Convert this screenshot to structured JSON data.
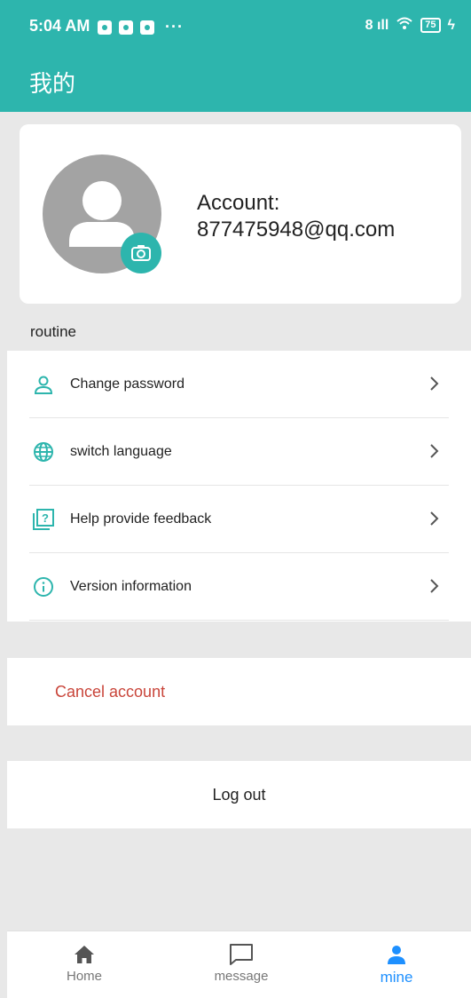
{
  "status_bar": {
    "time": "5:04 AM",
    "more": "···",
    "signal_text": "8 ıll",
    "battery": "75",
    "charge": "ϟ"
  },
  "app_bar": {
    "title": "我的"
  },
  "profile": {
    "account_label": "Account:",
    "account_value": "877475948@qq.com"
  },
  "section": {
    "label": "routine"
  },
  "menu": {
    "items": [
      {
        "label": "Change password",
        "icon": "user-icon"
      },
      {
        "label": "switch language",
        "icon": "globe-icon"
      },
      {
        "label": "Help provide feedback",
        "icon": "help-icon"
      },
      {
        "label": "Version information",
        "icon": "info-icon"
      }
    ]
  },
  "cancel_account": {
    "label": "Cancel account"
  },
  "logout": {
    "label": "Log out"
  },
  "bottom_nav": {
    "items": [
      {
        "label": "Home",
        "icon": "home-icon"
      },
      {
        "label": "message",
        "icon": "message-icon"
      },
      {
        "label": "mine",
        "icon": "person-icon",
        "active": true
      }
    ]
  },
  "colors": {
    "primary": "#2db5ad",
    "danger": "#c9453a",
    "active_nav": "#1e90ff",
    "background": "#e8e8e8"
  }
}
